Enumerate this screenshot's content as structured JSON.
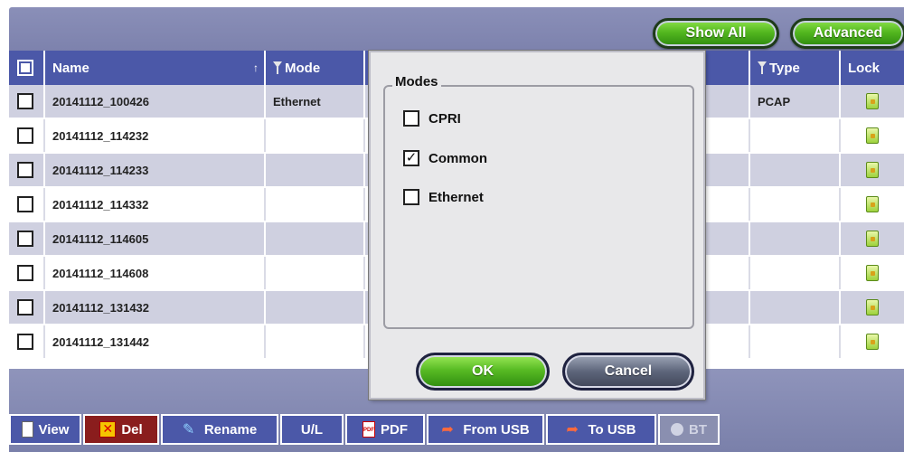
{
  "topbar": {
    "show_all": "Show All",
    "advanced": "Advanced"
  },
  "table": {
    "headers": {
      "name": "Name",
      "name_sort_icon": "sort-up-arrow",
      "mode": "Mode",
      "type": "Type",
      "lock": "Lock"
    },
    "rows": [
      {
        "name": "20141112_100426",
        "mode": "Ethernet",
        "type": "PCAP"
      },
      {
        "name": "20141112_114232",
        "mode": "",
        "type": ""
      },
      {
        "name": "20141112_114233",
        "mode": "",
        "type": ""
      },
      {
        "name": "20141112_114332",
        "mode": "",
        "type": ""
      },
      {
        "name": "20141112_114605",
        "mode": "",
        "type": ""
      },
      {
        "name": "20141112_114608",
        "mode": "",
        "type": ""
      },
      {
        "name": "20141112_131432",
        "mode": "",
        "type": ""
      },
      {
        "name": "20141112_131442",
        "mode": "",
        "type": ""
      }
    ]
  },
  "modal": {
    "legend": "Modes",
    "options": [
      {
        "label": "CPRI",
        "checked": false
      },
      {
        "label": "Common",
        "checked": true
      },
      {
        "label": "Ethernet",
        "checked": false
      }
    ],
    "ok": "OK",
    "cancel": "Cancel"
  },
  "toolbar": {
    "view": "View",
    "del": "Del",
    "rename": "Rename",
    "ul": "U/L",
    "pdf": "PDF",
    "from_usb": "From USB",
    "to_usb": "To USB",
    "bt": "BT"
  },
  "colors": {
    "header_bg": "#4b58a8",
    "row_alt": "#cfd0e0",
    "panel_bg": "#8a8fb8",
    "green_accent": "#53b71f"
  }
}
